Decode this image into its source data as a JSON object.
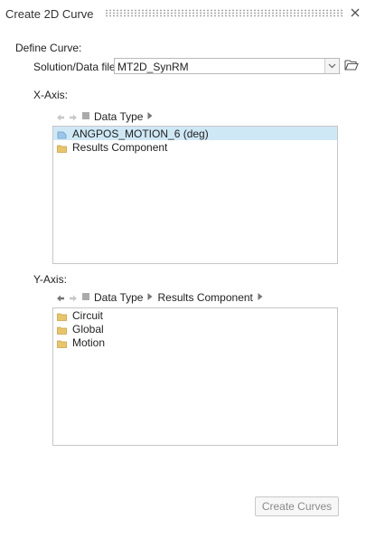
{
  "panel": {
    "title": "Create 2D Curve"
  },
  "define_curve": {
    "label": "Define Curve:",
    "solution_label": "Solution/Data file",
    "solution_value": "MT2D_SynRM"
  },
  "x_axis": {
    "label": "X-Axis:",
    "breadcrumb": [
      "Data Type"
    ],
    "items": [
      {
        "label": "ANGPOS_MOTION_6 (deg)",
        "icon": "curve-icon",
        "selected": true
      },
      {
        "label": "Results Component",
        "icon": "folder-icon",
        "selected": false
      }
    ]
  },
  "y_axis": {
    "label": "Y-Axis:",
    "breadcrumb": [
      "Data Type",
      "Results Component"
    ],
    "items": [
      {
        "label": "Circuit",
        "icon": "folder-icon"
      },
      {
        "label": "Global",
        "icon": "folder-icon"
      },
      {
        "label": "Motion",
        "icon": "folder-icon"
      }
    ]
  },
  "actions": {
    "create_curves_label": "Create Curves"
  },
  "colors": {
    "folder": "#e8c56b",
    "selection": "#cfe8f6",
    "disabled_text": "#8a8a8a"
  }
}
